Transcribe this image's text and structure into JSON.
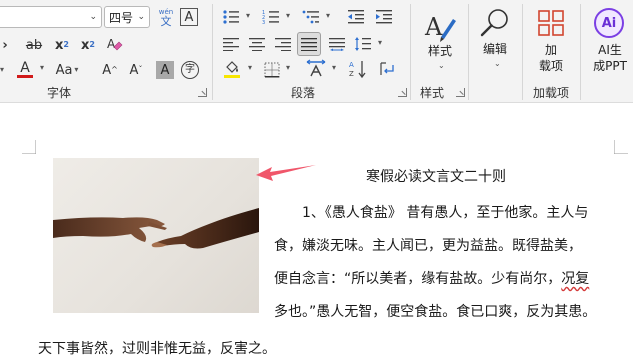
{
  "font": {
    "name_value": "",
    "size_value": "四号",
    "phonetic_top": "wén",
    "phonetic_bottom": "文",
    "char_border": "A",
    "strike": "ab",
    "subscript": "x",
    "subscript_mark": "2",
    "superscript": "x",
    "superscript_mark": "2",
    "font_color": "A",
    "change_case": "Aa",
    "grow": "A",
    "shrink": "A",
    "shade": "A",
    "enclose": "字",
    "group_label": "字体"
  },
  "paragraph": {
    "group_label": "段落"
  },
  "styles": {
    "button_label": "样式",
    "group_label": "样式"
  },
  "editing": {
    "button_label": "编辑"
  },
  "addins": {
    "button_label_line1": "加",
    "button_label_line2": "载项",
    "group_label": "加载项"
  },
  "ai": {
    "badge": "Ai",
    "label_line1": "AI生",
    "label_line2": "成PPT"
  },
  "document": {
    "title": "寒假必读文言文二十则",
    "lines": [
      "1、《愚人食盐》 昔有愚人，至于他家。主人与",
      "食，嫌淡无味。主人闻已，更为益盐。既得盐美，",
      "便自念言：“所以美者，缘有盐故。少有尚尔，",
      "多也。”愚人无智，便空食盐。食已口爽，反为其患。",
      "天下事皆然，过则非惟无益，反害之。"
    ],
    "line3_tail": "况复"
  },
  "colors": {
    "font_color_bar": "#d11a1a",
    "highlight_bar": "#f7e600",
    "annotation_arrow": "#f0566a",
    "styles_brush": "#2b6cc4",
    "addins_icon": "#d2452f",
    "ai_icon": "#7b3fe4"
  }
}
